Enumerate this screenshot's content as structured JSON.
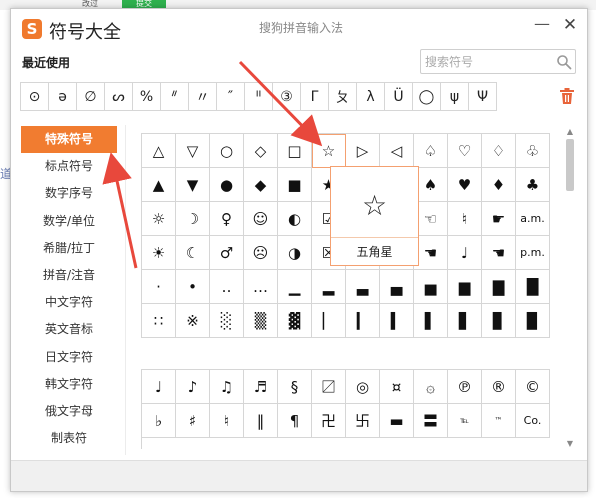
{
  "background": {
    "tab1": "改过",
    "tab2": "提交",
    "left_text": "道"
  },
  "app": {
    "logo_letter": "S",
    "title": "符号大全",
    "window_title": "搜狗拼音输入法"
  },
  "window_controls": {
    "minimize": "—",
    "close": "✕"
  },
  "recent": {
    "label": "最近使用",
    "symbols": [
      "⊙",
      "ə",
      "∅",
      "ᔕ",
      "%",
      "ᐥ",
      "〃",
      "″",
      "ᐦ",
      "③",
      "Γ",
      "ㄆ",
      "λ",
      "Ü",
      "◯",
      "ψ",
      "Ψ"
    ]
  },
  "search": {
    "placeholder": "搜索符号",
    "icon": "search-icon"
  },
  "categories": [
    {
      "label": "特殊符号",
      "active": true
    },
    {
      "label": "标点符号",
      "active": false
    },
    {
      "label": "数字序号",
      "active": false
    },
    {
      "label": "数学/单位",
      "active": false
    },
    {
      "label": "希腊/拉丁",
      "active": false
    },
    {
      "label": "拼音/注音",
      "active": false
    },
    {
      "label": "中文字符",
      "active": false
    },
    {
      "label": "英文音标",
      "active": false
    },
    {
      "label": "日文字符",
      "active": false
    },
    {
      "label": "韩文字符",
      "active": false
    },
    {
      "label": "俄文字母",
      "active": false
    },
    {
      "label": "制表符",
      "active": false
    }
  ],
  "grid1": [
    [
      "△",
      "▽",
      "○",
      "◇",
      "□",
      "☆",
      "▷",
      "◁",
      "♤",
      "♡",
      "♢",
      "♧"
    ],
    [
      "▲",
      "▼",
      "●",
      "◆",
      "■",
      "★",
      "",
      "",
      "♠",
      "♥",
      "♦",
      "♣"
    ],
    [
      "☼",
      "☽",
      "♀",
      "☺",
      "◐",
      "☑",
      "",
      "",
      "☜",
      "♮",
      "☛",
      "a.m."
    ],
    [
      "☀",
      "☾",
      "♂",
      "☹",
      "◑",
      "☒",
      "",
      "",
      "☚",
      "♩",
      "☚",
      "p.m."
    ],
    [
      "·",
      "•",
      "‥",
      "…",
      "▁",
      "▂",
      "▃",
      "▄",
      "▅",
      "▆",
      "▇",
      "█"
    ],
    [
      "∷",
      "※",
      "░",
      "▒",
      "▓",
      "▏",
      "▎",
      "▍",
      "▌",
      "▋",
      "▊",
      "▉"
    ]
  ],
  "grid2": [
    [
      "♩",
      "♪",
      "♫",
      "♬",
      "§",
      "〼",
      "◎",
      "¤",
      "۞",
      "℗",
      "®",
      "©"
    ],
    [
      "♭",
      "♯",
      "♮",
      "‖",
      "¶",
      "卍",
      "卐",
      "▬",
      "〓",
      "℡",
      "™",
      "Co."
    ]
  ],
  "tooltip": {
    "symbol": "☆",
    "name": "五角星"
  },
  "colors": {
    "accent": "#f17c30",
    "arrow": "#e8483c",
    "tooltip_border": "#f4a070"
  }
}
